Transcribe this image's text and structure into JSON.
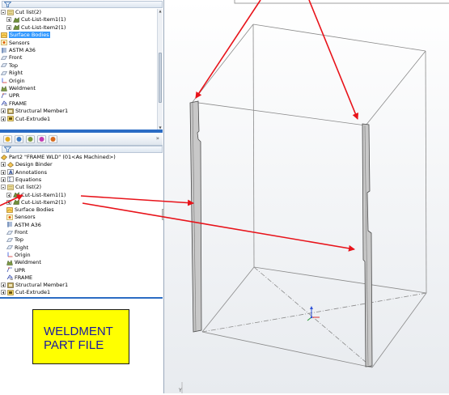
{
  "upper_tree": {
    "items": [
      {
        "label": "Cut list(2)",
        "icon": "cut-list-icon"
      },
      {
        "label": "Cut-List-Item1(1)",
        "icon": "weldment-member-icon"
      },
      {
        "label": "Cut-List-Item2(1)",
        "icon": "weldment-member-icon"
      },
      {
        "label": "Surface Bodies",
        "icon": "surface-bodies-icon",
        "selected": true
      },
      {
        "label": "Sensors",
        "icon": "sensors-icon"
      },
      {
        "label": "ASTM A36",
        "icon": "material-icon"
      },
      {
        "label": "Front",
        "icon": "plane-icon"
      },
      {
        "label": "Top",
        "icon": "plane-icon"
      },
      {
        "label": "Right",
        "icon": "plane-icon"
      },
      {
        "label": "Origin",
        "icon": "origin-icon"
      },
      {
        "label": "Weldment",
        "icon": "weldment-icon"
      },
      {
        "label": "UPR",
        "icon": "sketch-icon"
      },
      {
        "label": "FRAME",
        "icon": "3d-sketch-icon"
      },
      {
        "label": "Structural Member1",
        "icon": "structural-member-icon"
      },
      {
        "label": "Cut-Extrude1",
        "icon": "cut-extrude-icon"
      }
    ]
  },
  "lower_tree": {
    "items": [
      {
        "label": "Part2 \"FRAME WLD\" (01<As Machined>)",
        "icon": "part-icon"
      },
      {
        "label": "Design Binder",
        "icon": "design-binder-icon"
      },
      {
        "label": "Annotations",
        "icon": "annotations-icon"
      },
      {
        "label": "Equations",
        "icon": "equations-icon"
      },
      {
        "label": "Cut list(2)",
        "icon": "cut-list-icon"
      },
      {
        "label": "Cut-List-Item1(1)",
        "icon": "weldment-member-icon"
      },
      {
        "label": "Cut-List-Item2(1)",
        "icon": "weldment-member-icon"
      },
      {
        "label": "Surface Bodies",
        "icon": "surface-bodies-icon"
      },
      {
        "label": "Sensors",
        "icon": "sensors-icon"
      },
      {
        "label": "ASTM A36",
        "icon": "material-icon"
      },
      {
        "label": "Front",
        "icon": "plane-icon"
      },
      {
        "label": "Top",
        "icon": "plane-icon"
      },
      {
        "label": "Right",
        "icon": "plane-icon"
      },
      {
        "label": "Origin",
        "icon": "origin-icon"
      },
      {
        "label": "Weldment",
        "icon": "weldment-icon"
      },
      {
        "label": "UPR",
        "icon": "sketch-icon"
      },
      {
        "label": "FRAME",
        "icon": "3d-sketch-icon"
      },
      {
        "label": "Structural Member1",
        "icon": "structural-member-icon"
      },
      {
        "label": "Cut-Extrude1",
        "icon": "cut-extrude-icon"
      }
    ]
  },
  "panel_tabs": [
    {
      "name": "featuremanager-tab-icon"
    },
    {
      "name": "propertymanager-tab-icon"
    },
    {
      "name": "configurationmanager-tab-icon"
    },
    {
      "name": "dimxpert-tab-icon"
    },
    {
      "name": "display-manager-tab-icon"
    }
  ],
  "tabs_more_glyph": "»",
  "weldment_note": {
    "line1": "WELDMENT",
    "line2": "PART FILE"
  },
  "colors": {
    "arrow": "#e8131a",
    "selection": "#3399ff",
    "note_fill": "#ffff00",
    "note_text": "#1a1aa0",
    "divider": "#2b6cc4",
    "member_fill": "#c8c8c8"
  }
}
